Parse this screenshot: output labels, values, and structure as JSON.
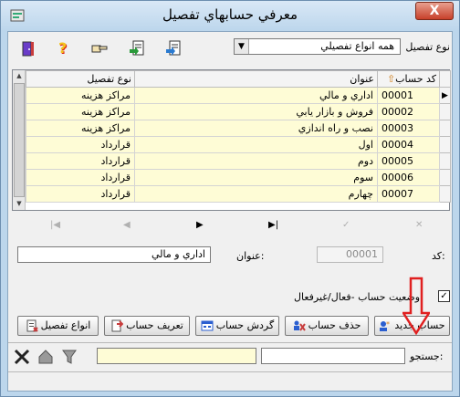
{
  "window": {
    "title": "معرفي حسابهاي تفصيل",
    "close_label": "X"
  },
  "toolbar": {
    "type_label": "نوع تفصيل",
    "type_value": "همه انواع تفصيلي",
    "icons": [
      "exit-door-icon",
      "help-icon",
      "pointing-hand-icon",
      "export-doc-icon",
      "import-doc-icon"
    ]
  },
  "grid": {
    "columns": {
      "code": "كد حساب",
      "title": "عنوان",
      "type": "نوع تفصيل"
    },
    "rows": [
      {
        "code": "00001",
        "title": "اداري و مالي",
        "type": "مراكز هزينه",
        "current": true
      },
      {
        "code": "00002",
        "title": "فروش و بازار يابي",
        "type": "مراكز هزينه",
        "current": false
      },
      {
        "code": "00003",
        "title": "نصب و راه اندازي",
        "type": "مراكز هزينه",
        "current": false
      },
      {
        "code": "00004",
        "title": "اول",
        "type": "قرارداد",
        "current": false
      },
      {
        "code": "00005",
        "title": "دوم",
        "type": "قرارداد",
        "current": false
      },
      {
        "code": "00006",
        "title": "سوم",
        "type": "قرارداد",
        "current": false
      },
      {
        "code": "00007",
        "title": "چهارم",
        "type": "قرارداد",
        "current": false
      }
    ]
  },
  "navigator": {
    "first": "|◀",
    "prior": "◀",
    "next": "▶",
    "last": "▶|",
    "edit": "✓",
    "cancel": "✕"
  },
  "detail": {
    "code_label": "كد:",
    "code_value": "00001",
    "title_label": "عنوان:",
    "title_value": "اداري و مالي",
    "status_label": "وضعيت حساب -فعال/غيرفعال",
    "status_checked": "✓"
  },
  "buttons": {
    "new_account": "حساب جديد",
    "delete_account": "حذف حساب",
    "account_turnover": "گردش حساب",
    "define_account": "تعريف حساب",
    "detail_types": "انواع تفصيل"
  },
  "search": {
    "label": "جستجو:"
  },
  "colors": {
    "row_highlight": "#fefcd6",
    "annotation_arrow": "#e02020"
  }
}
